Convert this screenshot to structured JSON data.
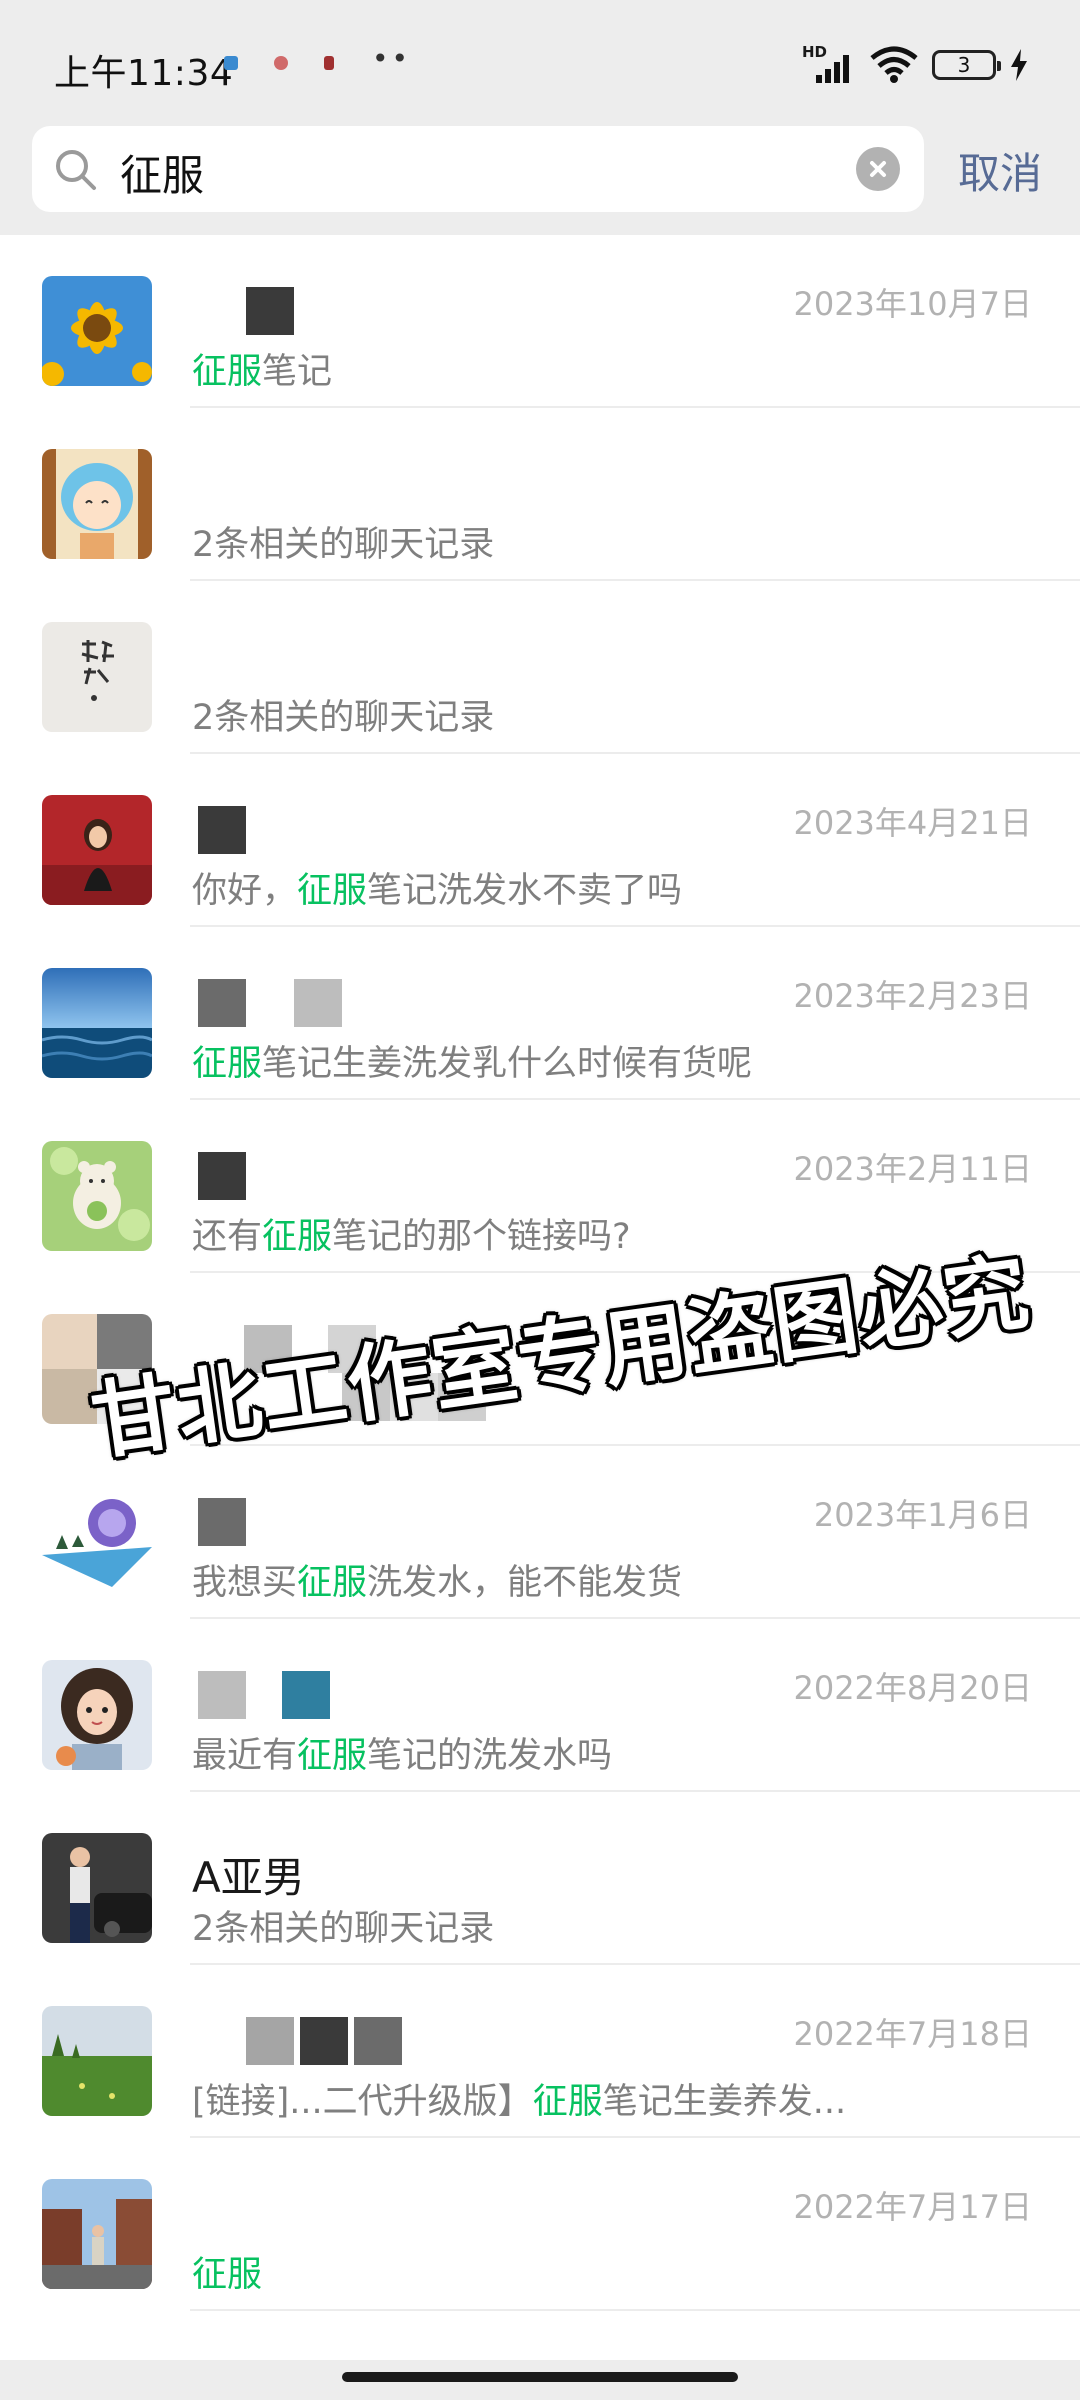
{
  "status_bar": {
    "time": "上午11:34",
    "network": "HD",
    "battery": "3"
  },
  "search": {
    "query": "征服",
    "cancel_label": "取消"
  },
  "results": [
    {
      "avatar": "sunflower",
      "name": "",
      "date": "2023年10月7日",
      "preview_pre": "",
      "preview_hl": "征服",
      "preview_post": "笔记"
    },
    {
      "avatar": "cartoon-girl",
      "name": "",
      "date": "",
      "preview_pre": "2条相关的聊天记录",
      "preview_hl": "",
      "preview_post": ""
    },
    {
      "avatar": "calligraphy",
      "name": "",
      "date": "",
      "preview_pre": "2条相关的聊天记录",
      "preview_hl": "",
      "preview_post": ""
    },
    {
      "avatar": "girl-red",
      "name": "",
      "date": "2023年4月21日",
      "preview_pre": "你好，",
      "preview_hl": "征服",
      "preview_post": "笔记洗发水不卖了吗"
    },
    {
      "avatar": "sea",
      "name": "",
      "date": "2023年2月23日",
      "preview_pre": "",
      "preview_hl": "征服",
      "preview_post": "笔记生姜洗发乳什么时候有货呢"
    },
    {
      "avatar": "bear",
      "name": "",
      "date": "2023年2月11日",
      "preview_pre": "还有",
      "preview_hl": "征服",
      "preview_post": "笔记的那个链接吗?"
    },
    {
      "avatar": "blurred",
      "name": "",
      "date": "",
      "preview_pre": "",
      "preview_hl": "",
      "preview_post": ""
    },
    {
      "avatar": "planet",
      "name": "",
      "date": "2023年1月6日",
      "preview_pre": "我想买",
      "preview_hl": "征服",
      "preview_post": "洗发水，能不能发货"
    },
    {
      "avatar": "curly-girl",
      "name": "",
      "date": "2022年8月20日",
      "preview_pre": "最近有",
      "preview_hl": "征服",
      "preview_post": "笔记的洗发水吗"
    },
    {
      "avatar": "woman-car",
      "name": "A亚男",
      "date": "",
      "preview_pre": "2条相关的聊天记录",
      "preview_hl": "",
      "preview_post": ""
    },
    {
      "avatar": "grassland",
      "name": "",
      "date": "2022年7月18日",
      "preview_pre": "[链接]...二代升级版】",
      "preview_hl": "征服",
      "preview_post": "笔记生姜养发..."
    },
    {
      "avatar": "street",
      "name": "",
      "date": "2022年7月17日",
      "preview_pre": "",
      "preview_hl": "征服",
      "preview_post": ""
    }
  ],
  "watermark": "甘北工作室专用盗图必究",
  "colors": {
    "highlight": "#07c160",
    "cancel": "#576b95",
    "date": "#b2b2b2",
    "preview": "#7f7f7f"
  }
}
